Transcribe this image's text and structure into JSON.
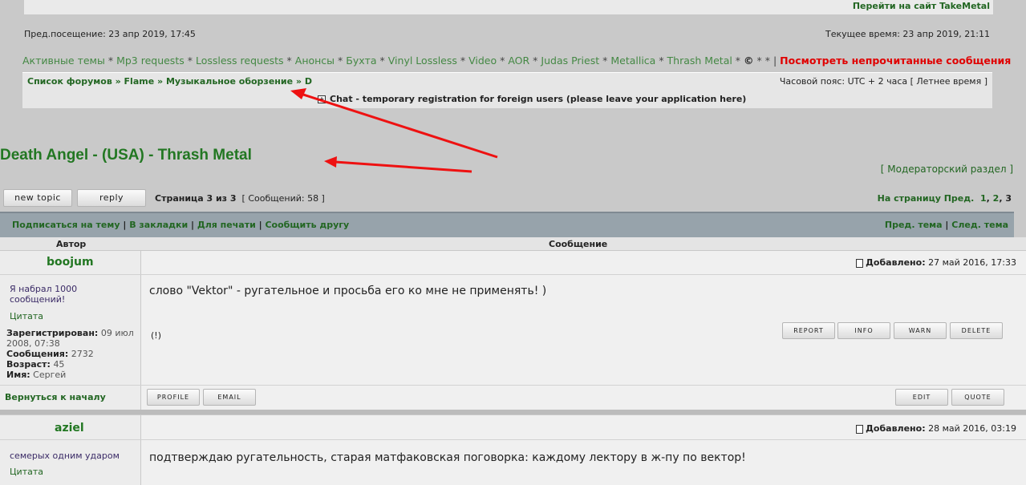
{
  "header": {
    "site_link": "Перейти на сайт TakeMetal",
    "prev_visit": "Пред.посещение: 23 апр 2019, 17:45",
    "current_time": "Текущее время: 23 апр 2019, 21:11"
  },
  "nav_links": [
    "Активные темы",
    "Mp3 requests",
    "Lossless requests",
    "Анонсы",
    "Бухта",
    "Vinyl Lossless",
    "Video",
    "AOR",
    "Judas Priest",
    "Metallica",
    "Thrash Metal",
    "©",
    "*"
  ],
  "nav_sep": " * ",
  "nav_sep_bar": " | ",
  "unread_link": "Посмотреть непрочитанные сообщения",
  "breadcrumb": {
    "items": [
      "Список форумов",
      "Flame",
      "Музыкальное оборзение",
      "D"
    ],
    "sep": " » "
  },
  "timezone": "Часовой пояс: UTC + 2 часа [ Летнее время ]",
  "chat_link": "Chat - temporary registration for foreign users (please leave your application here)",
  "topic_title": "Death Angel - (USA) - Thrash Metal",
  "moderator_section": "[ Модераторский раздел ]",
  "buttons": {
    "new_topic": "new topic",
    "reply": "reply"
  },
  "page_info": {
    "page": "Страница 3 из 3",
    "count": "[ Сообщений: 58 ]"
  },
  "pagination": {
    "label": "На страницу Пред.",
    "pages": [
      "1",
      "2",
      "3"
    ],
    "current": "3"
  },
  "toolbar": {
    "subscribe": "Подписаться на тему",
    "bookmark": "В закладки",
    "print": "Для печати",
    "email_friend": "Сообщить другу",
    "prev_topic": "Пред. тема",
    "next_topic": "След. тема"
  },
  "columns": {
    "author": "Автор",
    "message": "Сообщение"
  },
  "posts": [
    {
      "username": "boojum",
      "rank": "Я набрал 1000 сообщений!",
      "quote_label": "Цитата",
      "registered_label": "Зарегистрирован:",
      "registered": "09 июл 2008, 07:38",
      "messages_label": "Сообщения:",
      "messages": "2732",
      "age_label": "Возраст:",
      "age": "45",
      "name_label": "Имя:",
      "name": "Сергей",
      "added_label": "Добавлено:",
      "added": "27 май 2016, 17:33",
      "text": "слово \"Vektor\" - ругательное и просьба его ко мне не применять! )",
      "signature": "(!)",
      "back_to_top": "Вернуться к началу"
    },
    {
      "username": "aziel",
      "rank": "семерых одним ударом",
      "quote_label": "Цитата",
      "added_label": "Добавлено:",
      "added": "28 май 2016, 03:19",
      "text": "подтверждаю ругательность, старая матфаковская поговорка: каждому лектору в ж-пу по вектор!"
    }
  ],
  "post_buttons": {
    "report": "REPORT",
    "info": "INFO",
    "warn": "WARN",
    "delete": "DELETE",
    "profile": "PROFILE",
    "email": "EMAIL",
    "edit": "EDIT",
    "quote": "QUOTE"
  },
  "colors": {
    "link": "#226622",
    "unread": "#e00000",
    "annotation_arrow": "#ee1111"
  }
}
